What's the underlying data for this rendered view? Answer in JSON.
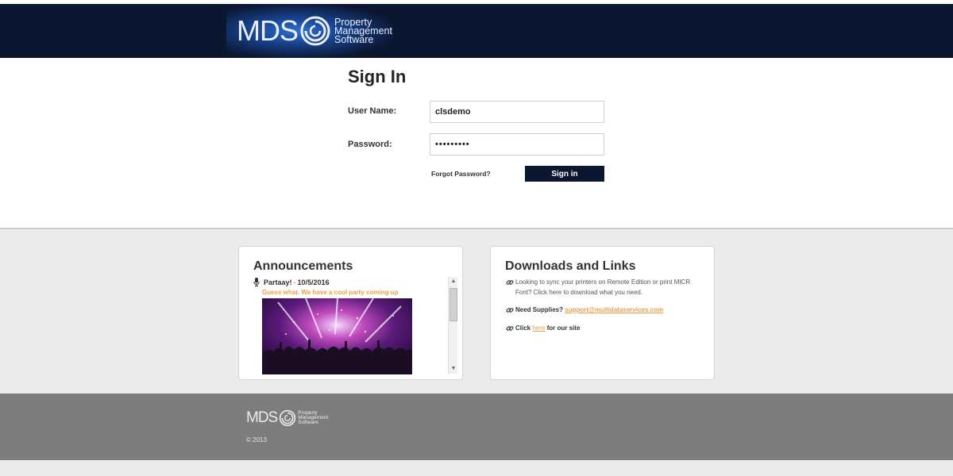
{
  "header": {
    "logo_mds": "MDS",
    "logo_line1": "Property",
    "logo_line2": "Management",
    "logo_line3": "Software",
    "logo_icon": "swirl-logo-icon"
  },
  "signin": {
    "title": "Sign In",
    "username_label": "User Name:",
    "username_value": "clsdemo",
    "password_label": "Password:",
    "password_value": "•••••••••",
    "forgot_label": "Forgot Password?",
    "button_label": "Sign in"
  },
  "announcements": {
    "title": "Announcements",
    "item_title": "Partaay!",
    "item_date": "10/5/2016",
    "item_dash": "-",
    "item_body": "Guess what. We have a cool party coming up",
    "item_icon": "microphone-icon",
    "image": "concert-crowd-image"
  },
  "downloads": {
    "title": "Downloads and Links",
    "link_icon": "chain-link-icon",
    "item1_line1": "Looking to sync your printers on Remote Edition or print MICR",
    "item1_line2": "Font?  Click here to download what you need.",
    "item2_prefix": "Need Supplies?",
    "item2_email": "support@multidataservices.com",
    "item3_prefix": "Click",
    "item3_link": "here",
    "item3_suffix": "for our site"
  },
  "footer": {
    "logo_mds": "MDS",
    "logo_line1": "Property",
    "logo_line2": "Management",
    "logo_line3": "Software",
    "copyright": "© 2013"
  },
  "colors": {
    "navy": "#0b1630",
    "accent_orange": "#e8a04a",
    "footer_gray": "#7d7d7d"
  }
}
